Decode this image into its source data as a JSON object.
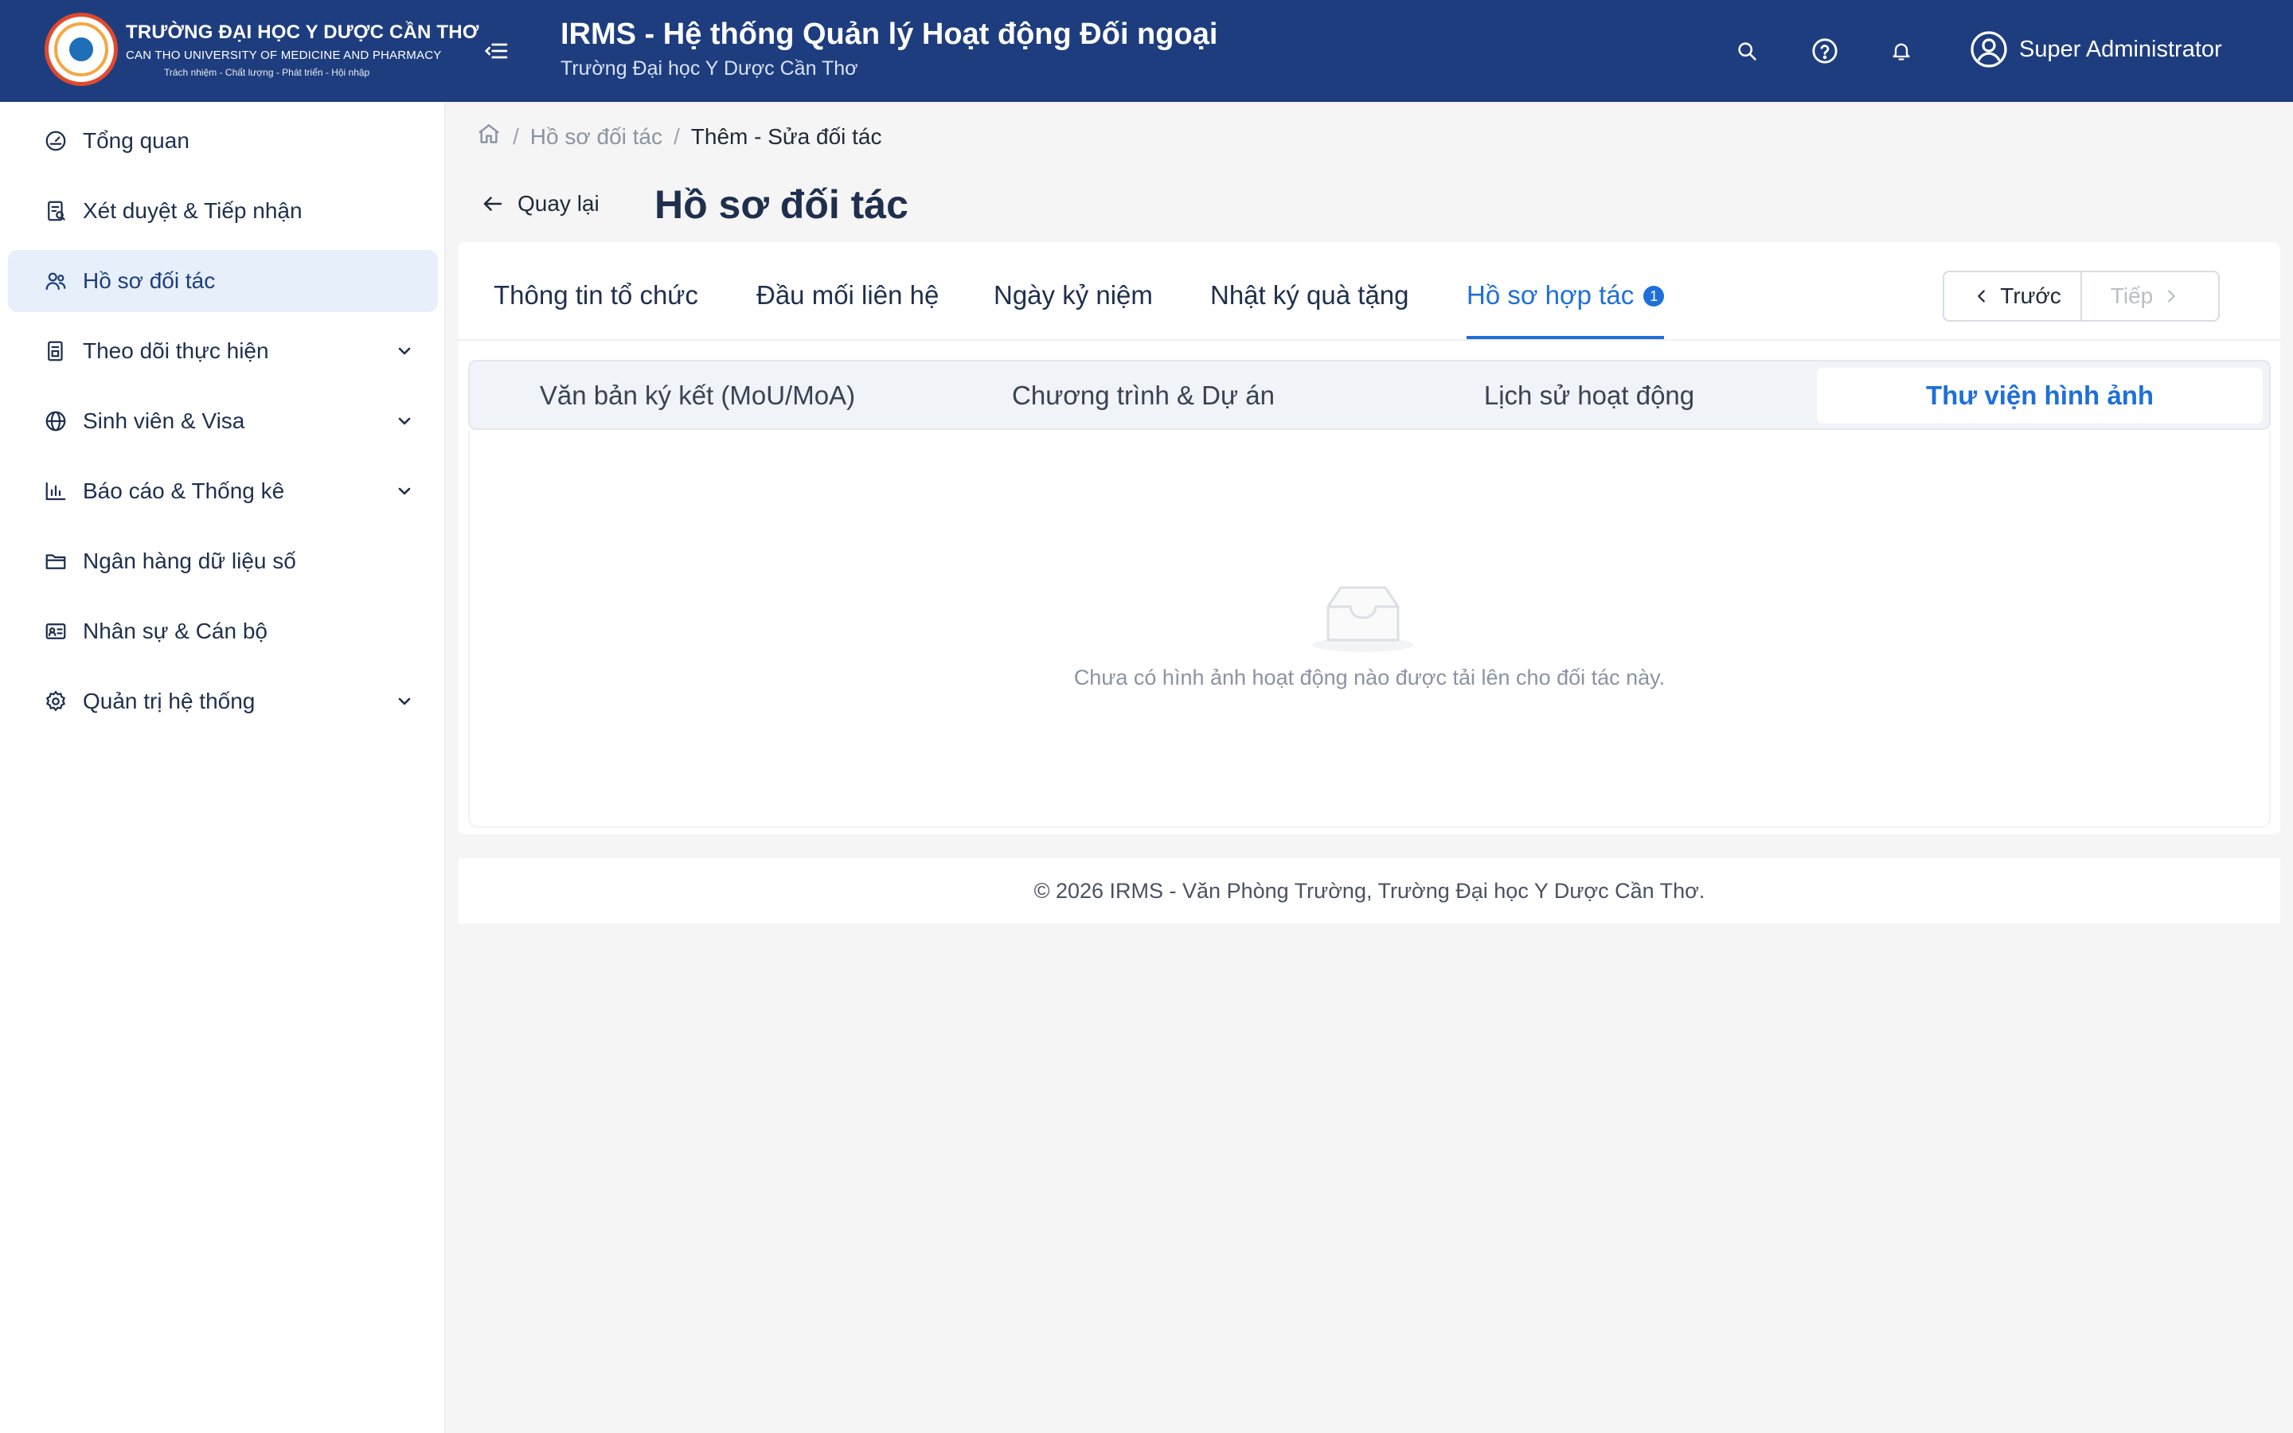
{
  "logo": {
    "line1": "TRƯỜNG ĐẠI HỌC Y DƯỢC CẦN THƠ",
    "line2": "CAN THO UNIVERSITY OF MEDICINE AND PHARMACY",
    "line3": "Trách nhiệm - Chất lượng - Phát triển - Hội nhập"
  },
  "header": {
    "title": "IRMS - Hệ thống Quản lý Hoạt động Đối ngoại",
    "subtitle": "Trường Đại học Y Dược Cần Thơ",
    "user_name": "Super Administrator"
  },
  "sidebar": {
    "items": [
      {
        "label": "Tổng quan",
        "icon": "dashboard-icon"
      },
      {
        "label": "Xét duyệt & Tiếp nhận",
        "icon": "review-icon"
      },
      {
        "label": "Hồ sơ đối tác",
        "icon": "partners-icon",
        "active": true
      },
      {
        "label": "Theo dõi thực hiện",
        "icon": "tracking-icon",
        "expandable": true
      },
      {
        "label": "Sinh viên & Visa",
        "icon": "globe-icon",
        "expandable": true
      },
      {
        "label": "Báo cáo & Thống kê",
        "icon": "chart-icon",
        "expandable": true
      },
      {
        "label": "Ngân hàng dữ liệu số",
        "icon": "folder-icon"
      },
      {
        "label": "Nhân sự & Cán bộ",
        "icon": "id-card-icon"
      },
      {
        "label": "Quản trị hệ thống",
        "icon": "gear-icon",
        "expandable": true
      }
    ]
  },
  "breadcrumb": {
    "items": [
      "Hồ sơ đối tác",
      "Thêm - Sửa đối tác"
    ]
  },
  "page": {
    "back_label": "Quay lại",
    "title": "Hồ sơ đối tác"
  },
  "tabs": {
    "items": [
      {
        "label": "Thông tin tổ chức"
      },
      {
        "label": "Đầu mối liên hệ"
      },
      {
        "label": "Ngày kỷ niệm"
      },
      {
        "label": "Nhật ký quà tặng"
      },
      {
        "label": "Hồ sơ hợp tác",
        "badge": "1",
        "active": true
      }
    ],
    "prev_label": "Trước",
    "next_label": "Tiếp"
  },
  "subtabs": {
    "items": [
      {
        "label": "Văn bản ký kết (MoU/MoA)"
      },
      {
        "label": "Chương trình & Dự án"
      },
      {
        "label": "Lịch sử hoạt động"
      },
      {
        "label": "Thư viện hình ảnh",
        "active": true
      }
    ]
  },
  "empty_state": {
    "message": "Chưa có hình ảnh hoạt động nào được tải lên cho đối tác này."
  },
  "footer": {
    "text": "© 2026 IRMS - Văn Phòng Trường, Trường Đại học Y Dược Cần Thơ."
  },
  "colors": {
    "header_bg": "#1e3d7e",
    "accent": "#1e6fd9",
    "active_nav_bg": "#e6effa"
  }
}
